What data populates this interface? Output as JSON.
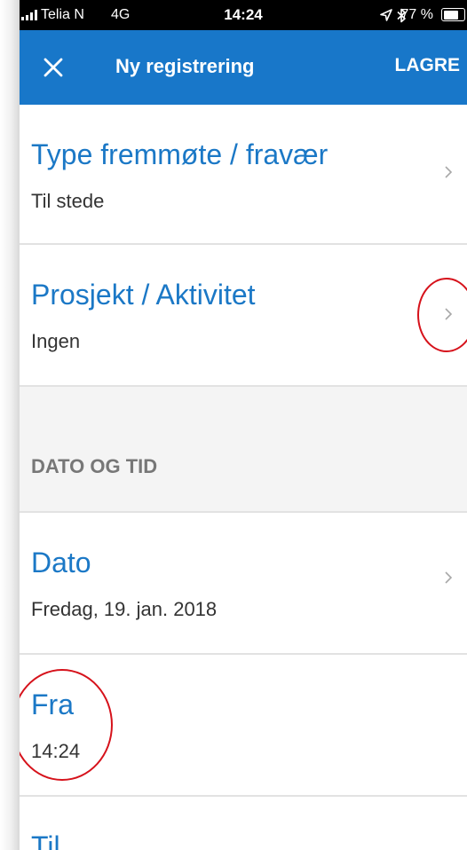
{
  "status_bar": {
    "carrier": "Telia N",
    "network": "4G",
    "time": "14:24",
    "battery": "77 %",
    "battery_level": 0.77,
    "icons": [
      "signal-icon",
      "location-arrow-icon",
      "bluetooth-icon",
      "battery-icon"
    ]
  },
  "nav": {
    "close_icon": "close-icon",
    "title": "Ny registrering",
    "save_label": "LAGRE"
  },
  "rows": [
    {
      "title": "Type fremmøte / fravær",
      "value": "Til stede",
      "chevron": true
    },
    {
      "title": "Prosjekt / Aktivitet",
      "value": "Ingen",
      "chevron": true
    }
  ],
  "section": {
    "header": "DATO OG TID"
  },
  "date_rows": [
    {
      "title": "Dato",
      "value": "Fredag, 19. jan. 2018",
      "chevron": true
    },
    {
      "title": "Fra",
      "value": "14:24",
      "chevron": false
    },
    {
      "title": "Til",
      "value": "",
      "chevron": false
    }
  ],
  "colors": {
    "brand": "#1877c9",
    "title_text": "#1b78c6",
    "annotation": "#d6121b"
  }
}
